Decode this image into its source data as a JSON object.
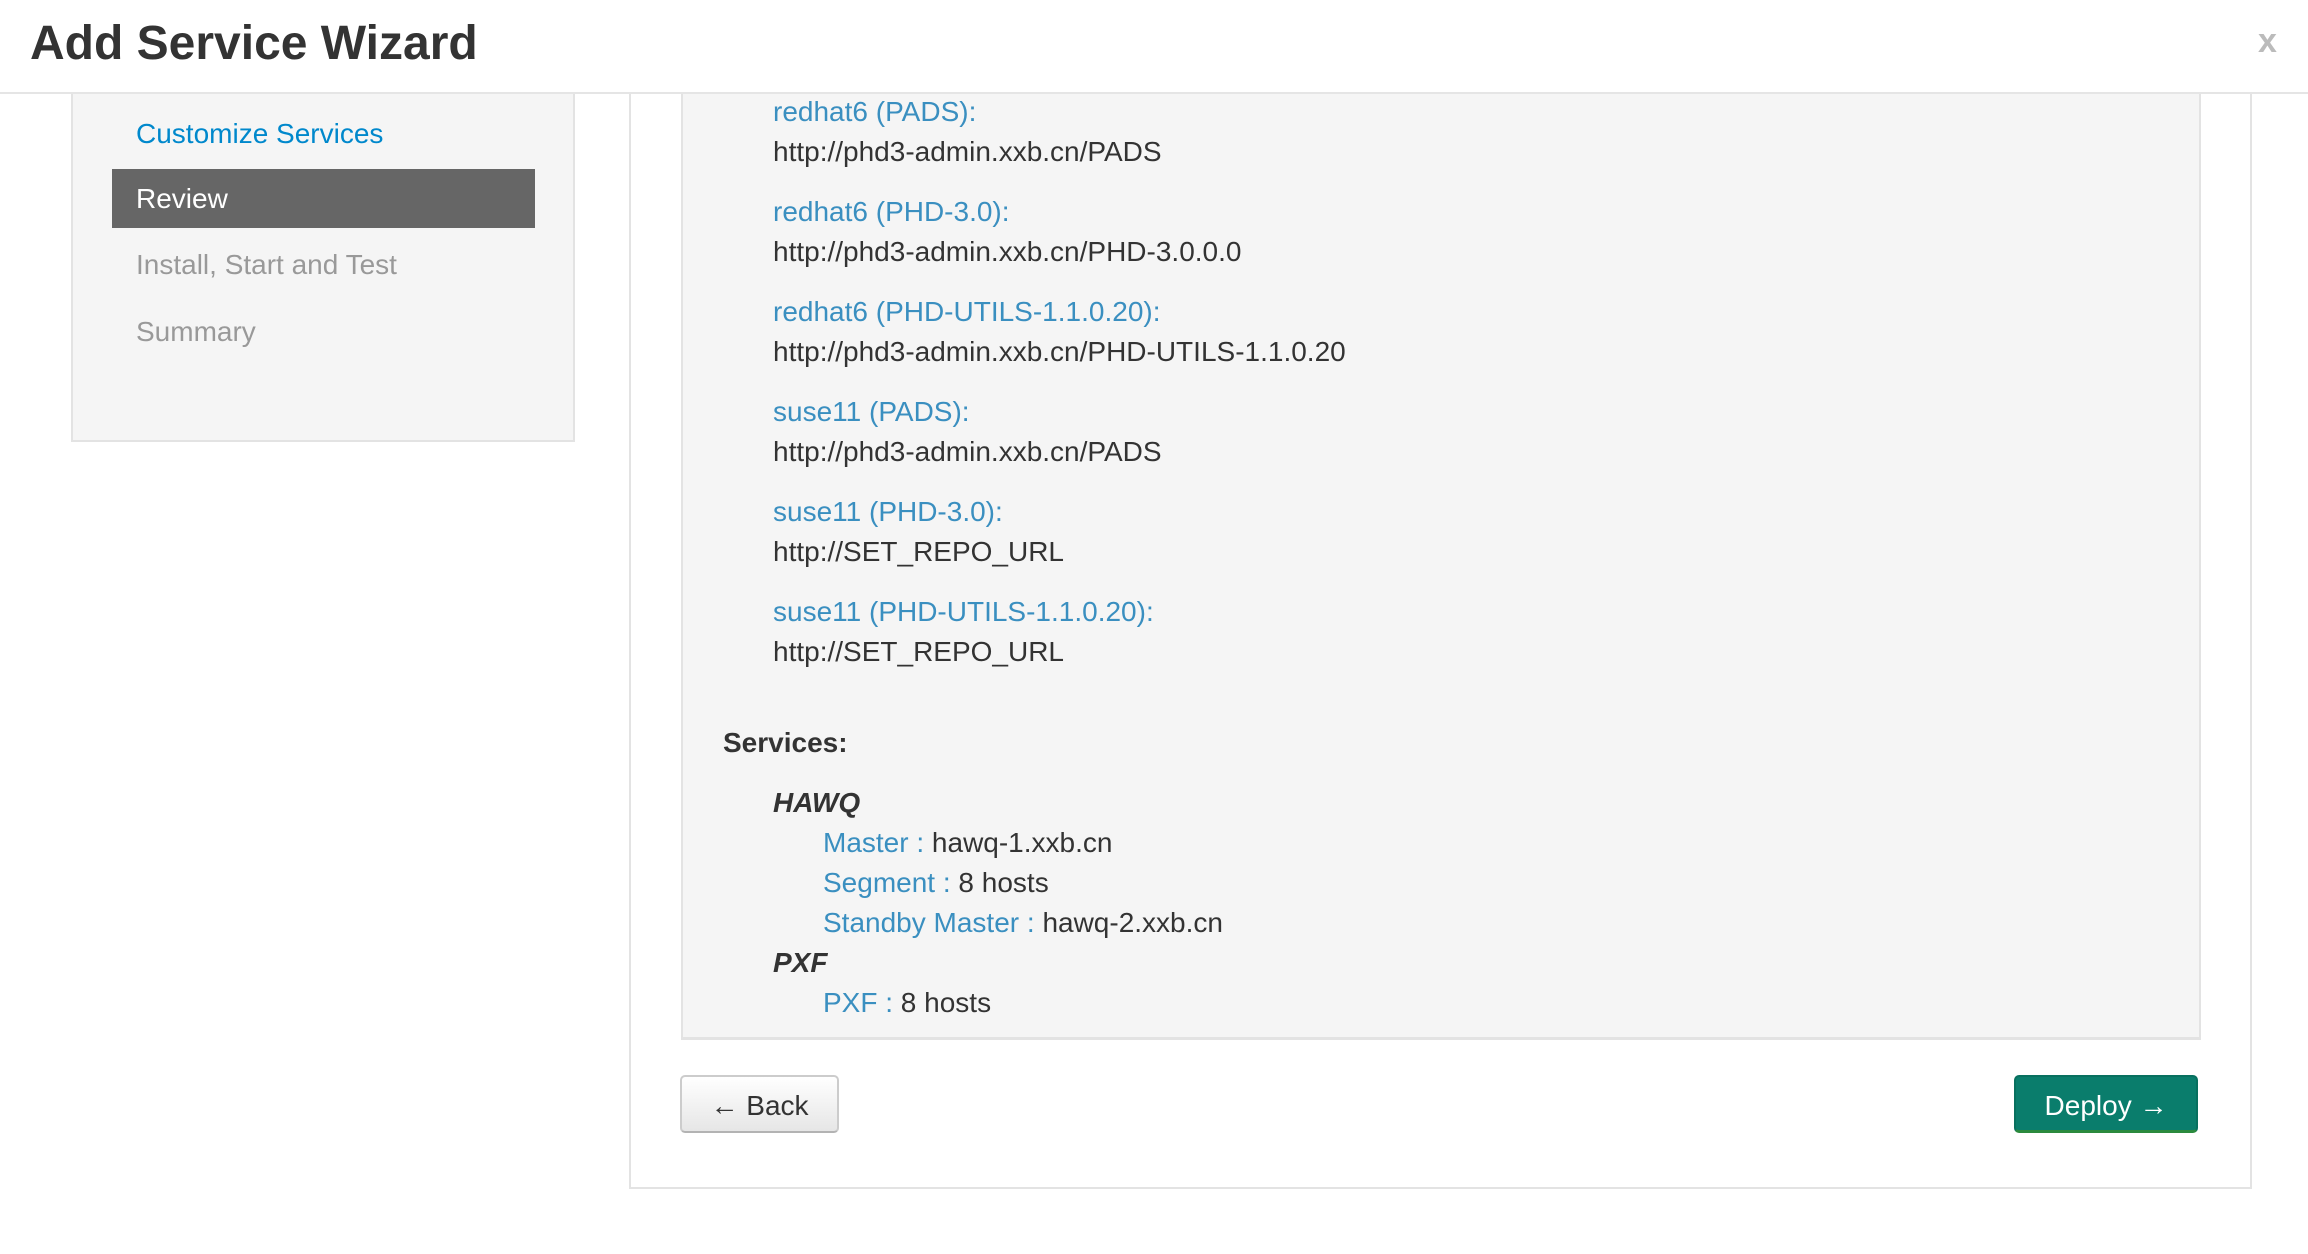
{
  "header": {
    "title": "Add Service Wizard",
    "close_label": "x"
  },
  "sidebar": {
    "steps": [
      {
        "label": "Customize Services",
        "state": "link"
      },
      {
        "label": "Review",
        "state": "active"
      },
      {
        "label": "Install, Start and Test",
        "state": "disabled"
      },
      {
        "label": "Summary",
        "state": "disabled"
      }
    ]
  },
  "repos": [
    {
      "label": "redhat6 (PADS):",
      "url": "http://phd3-admin.xxb.cn/PADS"
    },
    {
      "label": "redhat6 (PHD-3.0):",
      "url": "http://phd3-admin.xxb.cn/PHD-3.0.0.0"
    },
    {
      "label": "redhat6 (PHD-UTILS-1.1.0.20):",
      "url": "http://phd3-admin.xxb.cn/PHD-UTILS-1.1.0.20"
    },
    {
      "label": "suse11 (PADS):",
      "url": "http://phd3-admin.xxb.cn/PADS"
    },
    {
      "label": "suse11 (PHD-3.0):",
      "url": "http://SET_REPO_URL"
    },
    {
      "label": "suse11 (PHD-UTILS-1.1.0.20):",
      "url": "http://SET_REPO_URL"
    }
  ],
  "services": {
    "title": "Services:",
    "items": [
      {
        "name": "HAWQ",
        "components": [
          {
            "key": "Master :",
            "value": "hawq-1.xxb.cn"
          },
          {
            "key": "Segment :",
            "value": "8 hosts"
          },
          {
            "key": "Standby Master :",
            "value": "hawq-2.xxb.cn"
          }
        ]
      },
      {
        "name": "PXF",
        "components": [
          {
            "key": "PXF :",
            "value": "8 hosts"
          }
        ]
      }
    ]
  },
  "buttons": {
    "back": "← Back",
    "deploy": "Deploy →"
  },
  "colors": {
    "link": "#3a8fc0",
    "deploy": "#0a7d6c",
    "active_step": "#666666"
  }
}
